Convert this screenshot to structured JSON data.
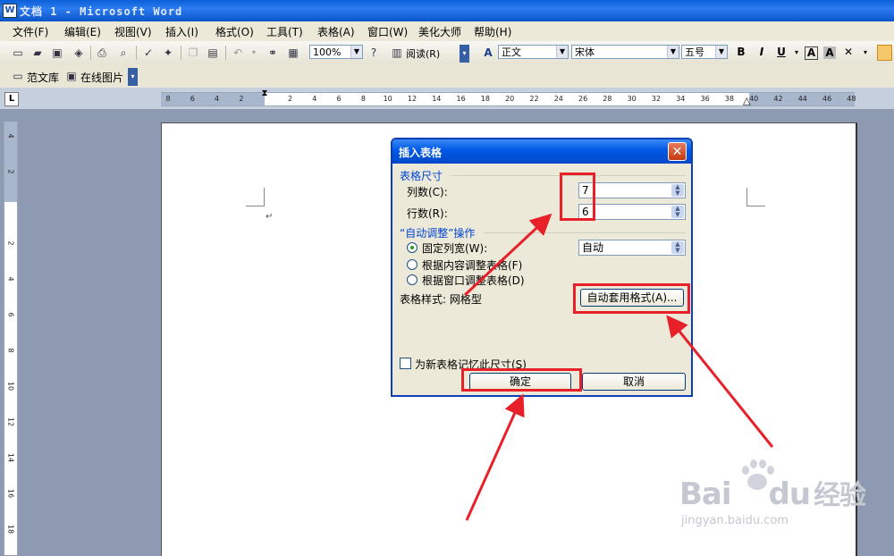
{
  "window": {
    "title": "文档 1 - Microsoft Word",
    "app_icon": "word-doc-icon"
  },
  "menu": [
    "文件(F)",
    "编辑(E)",
    "视图(V)",
    "插入(I)",
    "格式(O)",
    "工具(T)",
    "表格(A)",
    "窗口(W)",
    "美化大师",
    "帮助(H)"
  ],
  "toolbar": {
    "zoom": "100%",
    "read_label": "阅读(R)",
    "style": "正文",
    "font": "宋体",
    "size": "五号",
    "bold": "B",
    "italic": "I",
    "underline": "U",
    "char_border": "A",
    "char_shade": "A"
  },
  "toolbar2": {
    "item1": "范文库",
    "item2": "在线图片"
  },
  "ruler": {
    "numbers": [
      "8",
      "6",
      "4",
      "2",
      "2",
      "4",
      "6",
      "8",
      "10",
      "12",
      "14",
      "16",
      "18",
      "20",
      "22",
      "24",
      "26",
      "28",
      "30",
      "32",
      "34",
      "36",
      "38",
      "40",
      "42",
      "44",
      "46",
      "48"
    ],
    "vnumbers": [
      "4",
      "2",
      "2",
      "4",
      "6",
      "8",
      "10",
      "12",
      "14",
      "16",
      "18"
    ],
    "corner": "L"
  },
  "document": {
    "paragraph_mark": "↵"
  },
  "dialog": {
    "title": "插入表格",
    "close": "✕",
    "size_group": "表格尺寸",
    "cols_label": "列数(C):",
    "cols_value": "7",
    "rows_label": "行数(R):",
    "rows_value": "6",
    "autofit_group": "“自动调整”操作",
    "fixed_width_label": "固定列宽(W):",
    "fixed_width_value": "自动",
    "fit_content_label": "根据内容调整表格(F)",
    "fit_window_label": "根据窗口调整表格(D)",
    "style_label": "表格样式: 网格型",
    "autoformat_button": "自动套用格式(A)...",
    "remember_label": "为新表格记忆此尺寸(S)",
    "ok_button": "确定",
    "cancel_button": "取消"
  },
  "watermark": {
    "brand": "Bai",
    "brand2": "du",
    "cn": "经验",
    "url": "jingyan.baidu.com"
  },
  "colors": {
    "highlight": "#e8202a",
    "title_blue": "#0058e6",
    "group_blue": "#0046d5"
  }
}
